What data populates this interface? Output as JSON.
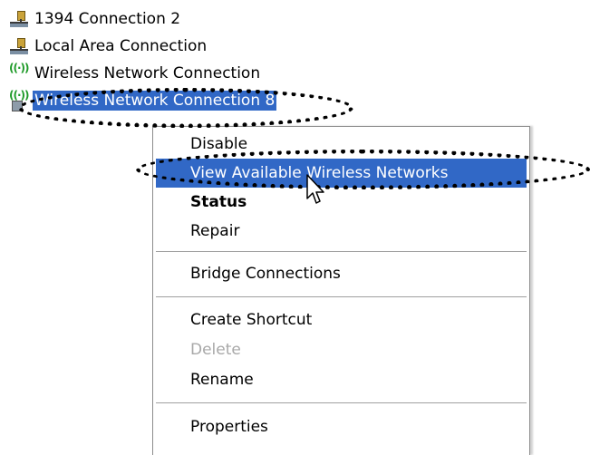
{
  "connections": [
    {
      "label": "1394 Connection 2",
      "icon": "wired-network-icon"
    },
    {
      "label": "Local Area Connection",
      "icon": "wired-network-icon"
    },
    {
      "label": "Wireless Network Connection",
      "icon": "wireless-network-icon"
    },
    {
      "label": "Wireless Network Connection 8",
      "icon": "wireless-network-icon",
      "selected": true
    }
  ],
  "context_menu": {
    "items": [
      {
        "label": "Disable"
      },
      {
        "label": "View Available Wireless Networks",
        "highlighted": true
      },
      {
        "label": "Status",
        "bold": true
      },
      {
        "label": "Repair"
      },
      {
        "label": "Bridge Connections"
      },
      {
        "label": "Create Shortcut"
      },
      {
        "label": "Delete",
        "disabled": true
      },
      {
        "label": "Rename"
      },
      {
        "label": "Properties"
      }
    ]
  },
  "colors": {
    "selection": "#3168c6",
    "disabled_text": "#a8a8a8",
    "wifi_signal": "#1e9a28"
  },
  "cursor": "arrow-pointer-icon"
}
